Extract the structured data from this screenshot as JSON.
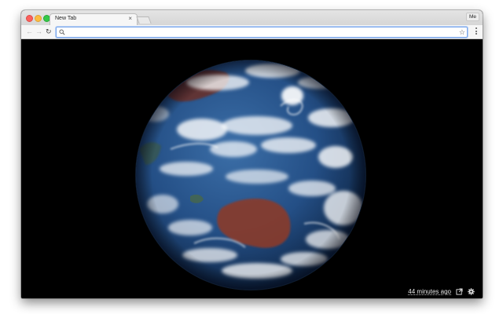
{
  "browser": {
    "tab_title": "New Tab",
    "tab_close": "×",
    "profile_label": "Me",
    "omnibox": {
      "value": "",
      "placeholder": ""
    }
  },
  "page": {
    "timestamp": "44 minutes ago"
  },
  "icons": {
    "back": "arrow-left",
    "forward": "arrow-right",
    "reload": "refresh",
    "search": "magnifier",
    "bookmark": "star-outline",
    "menu": "vertical-dots",
    "open_external": "external-link",
    "settings": "gear"
  },
  "colors": {
    "background": "#000000",
    "ocean": "#1f4f8a",
    "cloud": "#ffffff",
    "land": "#8a3a2c"
  }
}
